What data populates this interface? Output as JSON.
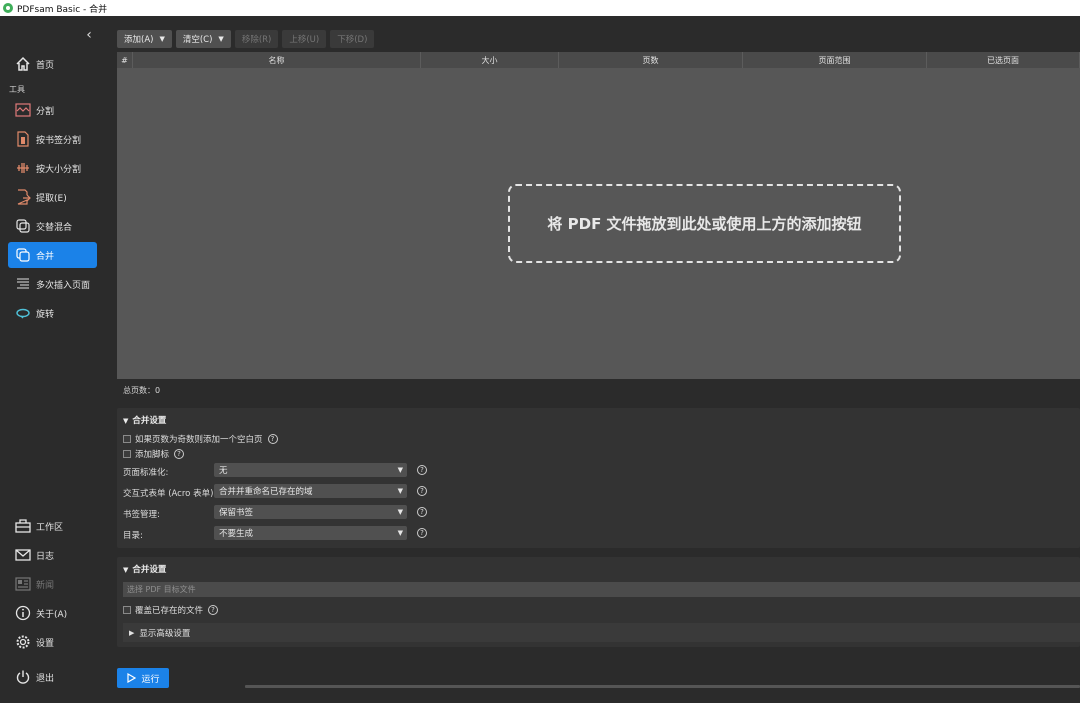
{
  "window": {
    "title": "PDFsam Basic - 合并"
  },
  "sidebar": {
    "home": "首页",
    "tools_label": "工具",
    "tools": [
      {
        "label": "分割",
        "icon": "split-icon"
      },
      {
        "label": "按书签分割",
        "icon": "split-by-bookmarks-icon"
      },
      {
        "label": "按大小分割",
        "icon": "split-by-size-icon"
      },
      {
        "label": "提取(E)",
        "icon": "extract-icon"
      },
      {
        "label": "交替混合",
        "icon": "alternate-mix-icon"
      },
      {
        "label": "合并",
        "icon": "merge-icon",
        "active": true
      },
      {
        "label": "多次插入页面",
        "icon": "insert-pages-icon"
      },
      {
        "label": "旋转",
        "icon": "rotate-icon"
      }
    ],
    "bottom": [
      {
        "label": "工作区",
        "icon": "briefcase-icon"
      },
      {
        "label": "日志",
        "icon": "log-icon"
      },
      {
        "label": "新闻",
        "icon": "news-icon",
        "disabled": true
      },
      {
        "label": "关于(A)",
        "icon": "info-icon"
      },
      {
        "label": "设置",
        "icon": "gear-icon"
      },
      {
        "label": "退出",
        "icon": "power-icon"
      }
    ]
  },
  "toolbar": {
    "add": "添加(A)",
    "clear": "清空(C)",
    "remove": "移除(R)",
    "move_up": "上移(U)",
    "move_down": "下移(D)"
  },
  "table": {
    "columns": [
      "#",
      "名称",
      "大小",
      "页数",
      "页面范围",
      "已选页面"
    ],
    "dropzone_text": "将 PDF 文件拖放到此处或使用上方的添加按钮"
  },
  "total_pages": "总页数：0",
  "merge_settings": {
    "title": "合并设置",
    "blank_page_checkbox": "如果页数为奇数则添加一个空白页",
    "footer_checkbox": "添加脚标",
    "page_norm_label": "页面标准化:",
    "page_norm_value": "无",
    "acro_label": "交互式表单 (Acro 表单):",
    "acro_value": "合并并重命名已存在的域",
    "bookmarks_label": "书签管理:",
    "bookmarks_value": "保留书签",
    "toc_label": "目录:",
    "toc_value": "不要生成"
  },
  "output_settings": {
    "title": "合并设置",
    "dest_placeholder": "选择 PDF 目标文件",
    "overwrite_checkbox": "覆盖已存在的文件",
    "advanced": "显示高级设置"
  },
  "run_button": "运行"
}
